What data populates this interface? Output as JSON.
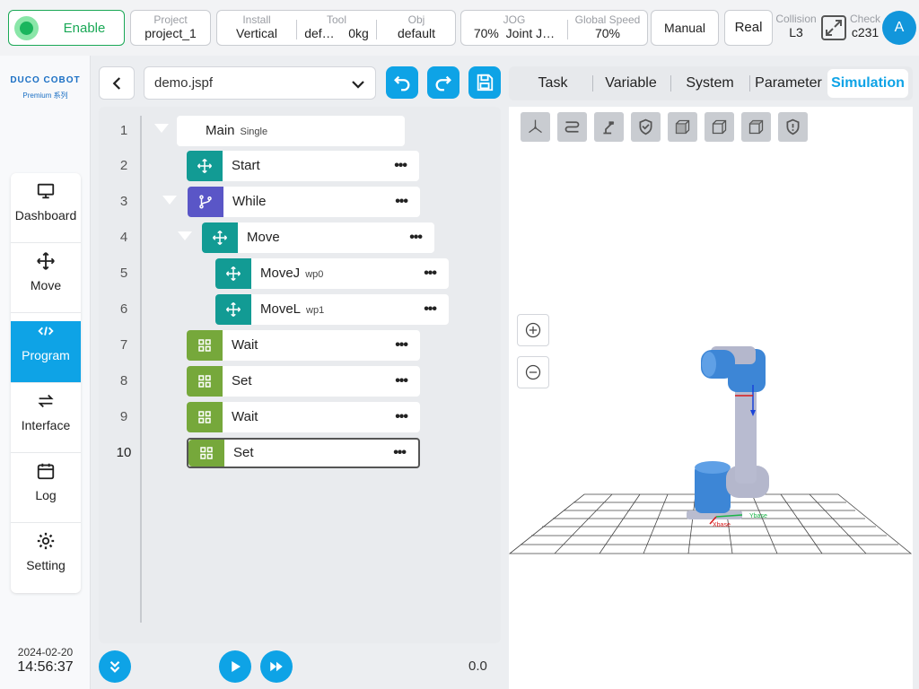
{
  "topbar": {
    "enable": "Enable",
    "project": {
      "label": "Project",
      "value": "project_1"
    },
    "install": {
      "label": "Install",
      "value": "Vertical"
    },
    "tool": {
      "label": "Tool",
      "value1": "def…",
      "value2": "0kg"
    },
    "obj": {
      "label": "Obj",
      "value": "default"
    },
    "jog": {
      "label": "JOG",
      "value1": "70%",
      "value2": "Joint J…"
    },
    "global_speed": {
      "label": "Global Speed",
      "value": "70%"
    },
    "mode": "Manual",
    "real": "Real",
    "collision": {
      "label": "Collision",
      "value": "L3"
    },
    "check": {
      "label": "Check",
      "value": "c231"
    },
    "avatar": "A"
  },
  "sidebar": {
    "logo": "DUCO COBOT",
    "logo_sub": "Premium 系列",
    "items": [
      {
        "label": "Dashboard",
        "icon": "monitor-icon"
      },
      {
        "label": "Move",
        "icon": "move-icon"
      },
      {
        "label": "Program",
        "icon": "code-icon",
        "active": true
      },
      {
        "label": "Interface",
        "icon": "swap-icon"
      },
      {
        "label": "Log",
        "icon": "calendar-icon"
      },
      {
        "label": "Setting",
        "icon": "gear-icon"
      }
    ],
    "date": "2024-02-20",
    "time": "14:56:37"
  },
  "editor": {
    "file": "demo.jspf",
    "progress": "0.0"
  },
  "tree": [
    {
      "line": "1",
      "title": "Main",
      "sub": "Single"
    },
    {
      "line": "2",
      "title": "Start",
      "sub": "",
      "icon": "move-icon",
      "color": "teal"
    },
    {
      "line": "3",
      "title": "While",
      "sub": "",
      "icon": "branch-icon",
      "color": "purple"
    },
    {
      "line": "4",
      "title": "Move",
      "sub": "",
      "icon": "move-icon",
      "color": "teal"
    },
    {
      "line": "5",
      "title": "MoveJ",
      "sub": "wp0",
      "icon": "move-icon",
      "color": "teal"
    },
    {
      "line": "6",
      "title": "MoveL",
      "sub": "wp1",
      "icon": "move-icon",
      "color": "teal"
    },
    {
      "line": "7",
      "title": "Wait",
      "sub": "",
      "icon": "grid-icon",
      "color": "green"
    },
    {
      "line": "8",
      "title": "Set",
      "sub": "",
      "icon": "grid-icon",
      "color": "green"
    },
    {
      "line": "9",
      "title": "Wait",
      "sub": "",
      "icon": "grid-icon",
      "color": "green"
    },
    {
      "line": "10",
      "title": "Set",
      "sub": "",
      "icon": "grid-icon",
      "color": "green",
      "selected": true
    }
  ],
  "tabs": [
    "Task",
    "Variable",
    "System",
    "Parameter",
    "Simulation"
  ],
  "active_tab": "Simulation",
  "sim": {
    "axis_x": "Xbase",
    "axis_y": "Ybase"
  }
}
